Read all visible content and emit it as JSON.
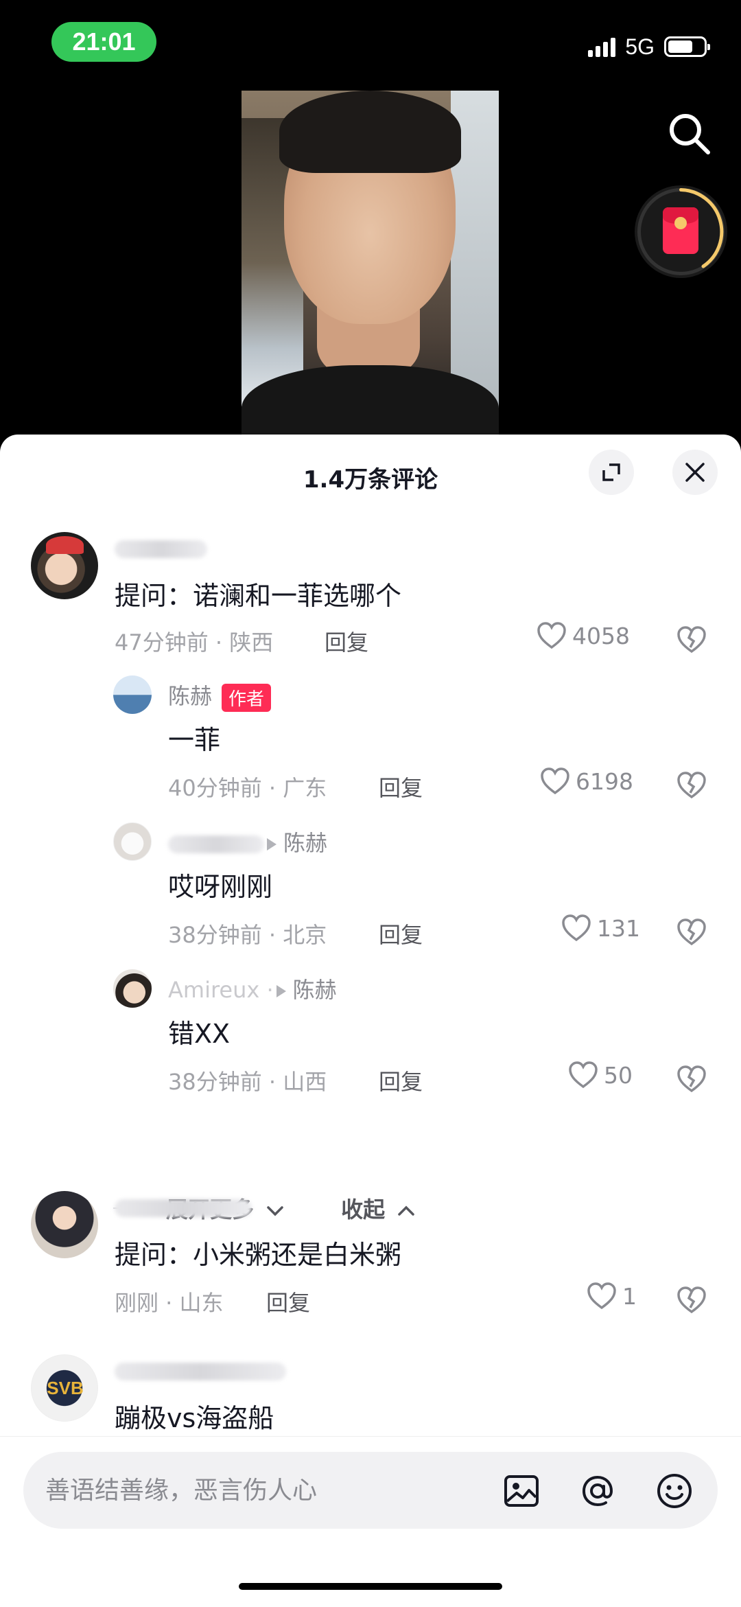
{
  "status_bar": {
    "time": "21:01",
    "network": "5G",
    "battery_percent": 70
  },
  "sheet": {
    "title": "1.4万条评论",
    "expand_icon": "expand-icon",
    "close_icon": "close-icon"
  },
  "comments": [
    {
      "text": "提问：诺澜和一菲选哪个",
      "meta": "47分钟前 · 陕西",
      "reply": "回复",
      "likes": "4058"
    },
    {
      "username": "陈赫",
      "badge": "作者",
      "text": "一菲",
      "meta": "40分钟前 · 广东",
      "reply": "回复",
      "likes": "6198"
    },
    {
      "reply_to": "陈赫",
      "text": "哎呀刚刚",
      "meta": "38分钟前 · 北京",
      "reply": "回复",
      "likes": "131"
    },
    {
      "username": "Amireux ·",
      "reply_to": "陈赫",
      "text": "错XX",
      "meta": "38分钟前 · 山西",
      "reply": "回复",
      "likes": "50"
    },
    {
      "text": "提问：小米粥还是白米粥",
      "meta": "刚刚 · 山东",
      "reply": "回复",
      "likes": "1"
    },
    {
      "text": "蹦极vs海盗船"
    }
  ],
  "thread_controls": {
    "expand_more": "展开更多",
    "collapse": "收起"
  },
  "input": {
    "placeholder": "善语结善缘，恶言伤人心"
  },
  "icons": [
    "search-icon",
    "red-packet-icon",
    "heart-icon",
    "dislike-icon",
    "image-icon",
    "at-icon",
    "emoji-icon"
  ],
  "colors": {
    "accent": "#fe2c55",
    "time_pill": "#34c759"
  }
}
